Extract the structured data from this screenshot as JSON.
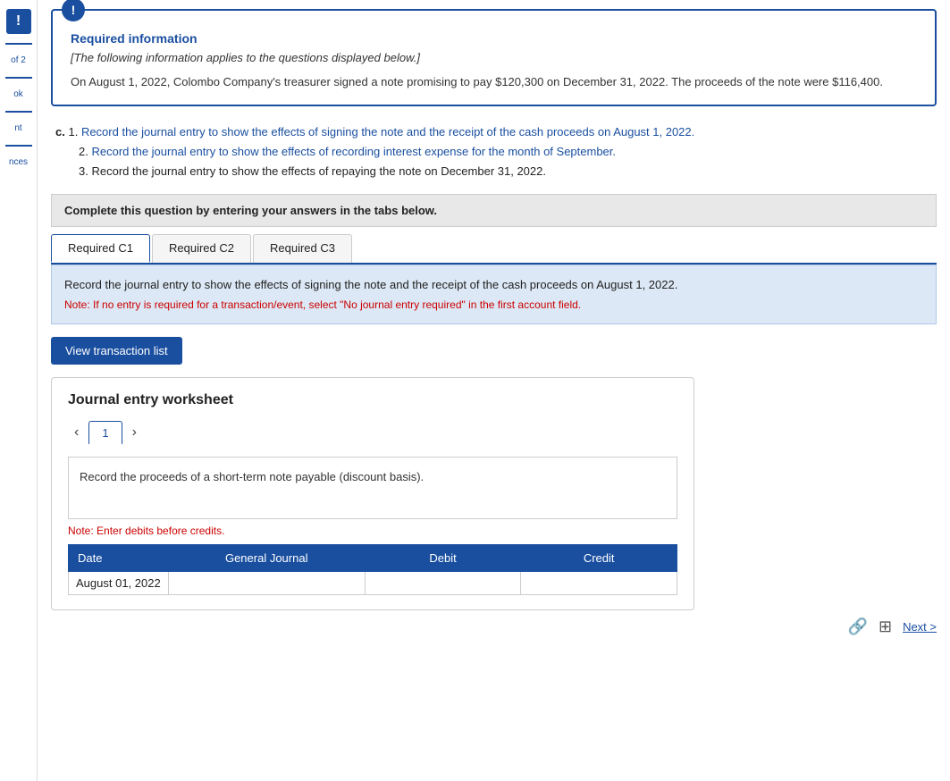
{
  "sidebar": {
    "icon_label": "!",
    "items": [
      {
        "label": "of 2",
        "active": true
      },
      {
        "label": "ok"
      },
      {
        "label": "nt"
      },
      {
        "label": "nces"
      }
    ]
  },
  "info_box": {
    "title": "Required information",
    "subtitle": "[The following information applies to the questions displayed below.]",
    "body": "On August 1, 2022, Colombo Company's treasurer signed a note promising to pay $120,300 on December 31, 2022. The proceeds of the note were $116,400."
  },
  "question": {
    "label": "c.",
    "items": [
      {
        "number": "1.",
        "text": "Record the journal entry to show the effects of signing the note and the receipt of the cash proceeds on August 1, 2022."
      },
      {
        "number": "2.",
        "text": "Record the journal entry to show the effects of recording interest expense for the month of September."
      },
      {
        "number": "3.",
        "text": "Record the journal entry to show the effects of repaying the note on December 31, 2022."
      }
    ]
  },
  "instruction_bar": {
    "text": "Complete this question by entering your answers in the tabs below."
  },
  "tabs": [
    {
      "label": "Required C1",
      "active": true
    },
    {
      "label": "Required C2",
      "active": false
    },
    {
      "label": "Required C3",
      "active": false
    }
  ],
  "blue_info": {
    "text": "Record the journal entry to show the effects of signing the note and the receipt of the cash proceeds on August 1, 2022.",
    "note": "Note: If no entry is required for a transaction/event, select \"No journal entry required\" in the first account field."
  },
  "view_transaction_btn": "View transaction list",
  "journal_worksheet": {
    "title": "Journal entry worksheet",
    "page_number": "1",
    "description": "Record the proceeds of a short-term note payable (discount basis).",
    "note_red": "Note: Enter debits before credits.",
    "table": {
      "headers": [
        "Date",
        "General Journal",
        "Debit",
        "Credit"
      ],
      "rows": [
        {
          "date": "August 01, 2022",
          "journal": "",
          "debit": "",
          "credit": ""
        }
      ]
    }
  },
  "bottom": {
    "prev_icon": "←",
    "next_icon": "→",
    "link_icon": "🔗",
    "grid_icon": "⊞",
    "next_label": "Next >"
  }
}
